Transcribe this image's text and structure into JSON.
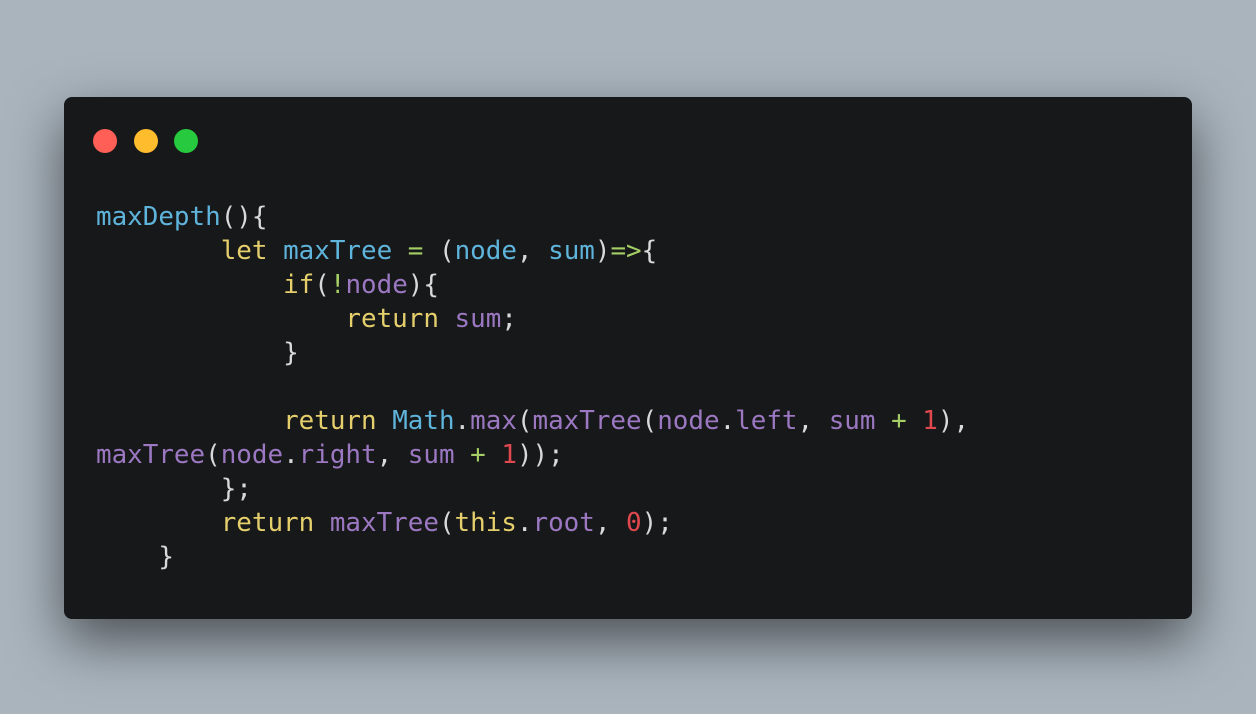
{
  "window": {
    "controls": [
      {
        "name": "close",
        "color": "#ff5f56"
      },
      {
        "name": "minimize",
        "color": "#ffbd2e"
      },
      {
        "name": "maximize",
        "color": "#27c93f"
      }
    ]
  },
  "colors": {
    "background": "#a9b4bd",
    "editor_background": "#171819",
    "function": "#5fb4dc",
    "identifier": "#9b78c1",
    "keyword": "#e5cf6c",
    "number": "#e0484f",
    "operator": "#a5cf66",
    "punctuation": "#d9d9d9"
  },
  "code": {
    "lines": [
      [
        {
          "t": "maxDepth",
          "c": "fn"
        },
        {
          "t": "(){",
          "c": "pun"
        }
      ],
      [
        {
          "t": "        ",
          "c": "pun"
        },
        {
          "t": "let",
          "c": "kw"
        },
        {
          "t": " ",
          "c": "pun"
        },
        {
          "t": "maxTree",
          "c": "fn"
        },
        {
          "t": " ",
          "c": "pun"
        },
        {
          "t": "=",
          "c": "op"
        },
        {
          "t": " (",
          "c": "pun"
        },
        {
          "t": "node",
          "c": "fn"
        },
        {
          "t": ", ",
          "c": "pun"
        },
        {
          "t": "sum",
          "c": "fn"
        },
        {
          "t": ")",
          "c": "pun"
        },
        {
          "t": "=>",
          "c": "op"
        },
        {
          "t": "{",
          "c": "pun"
        }
      ],
      [
        {
          "t": "            ",
          "c": "pun"
        },
        {
          "t": "if",
          "c": "kw"
        },
        {
          "t": "(",
          "c": "pun"
        },
        {
          "t": "!",
          "c": "op"
        },
        {
          "t": "node",
          "c": "id"
        },
        {
          "t": "){",
          "c": "pun"
        }
      ],
      [
        {
          "t": "                ",
          "c": "pun"
        },
        {
          "t": "return",
          "c": "kw"
        },
        {
          "t": " ",
          "c": "pun"
        },
        {
          "t": "sum",
          "c": "id"
        },
        {
          "t": ";",
          "c": "pun"
        }
      ],
      [
        {
          "t": "            ",
          "c": "pun"
        },
        {
          "t": "}",
          "c": "pun"
        }
      ],
      [],
      [
        {
          "t": "            ",
          "c": "pun"
        },
        {
          "t": "return",
          "c": "kw"
        },
        {
          "t": " ",
          "c": "pun"
        },
        {
          "t": "Math",
          "c": "fn"
        },
        {
          "t": ".",
          "c": "pun"
        },
        {
          "t": "max",
          "c": "id"
        },
        {
          "t": "(",
          "c": "pun"
        },
        {
          "t": "maxTree",
          "c": "id"
        },
        {
          "t": "(",
          "c": "pun"
        },
        {
          "t": "node",
          "c": "id"
        },
        {
          "t": ".",
          "c": "pun"
        },
        {
          "t": "left",
          "c": "id"
        },
        {
          "t": ", ",
          "c": "pun"
        },
        {
          "t": "sum",
          "c": "id"
        },
        {
          "t": " ",
          "c": "pun"
        },
        {
          "t": "+",
          "c": "op"
        },
        {
          "t": " ",
          "c": "pun"
        },
        {
          "t": "1",
          "c": "num"
        },
        {
          "t": "),",
          "c": "pun"
        }
      ],
      [
        {
          "t": "maxTree",
          "c": "id"
        },
        {
          "t": "(",
          "c": "pun"
        },
        {
          "t": "node",
          "c": "id"
        },
        {
          "t": ".",
          "c": "pun"
        },
        {
          "t": "right",
          "c": "id"
        },
        {
          "t": ", ",
          "c": "pun"
        },
        {
          "t": "sum",
          "c": "id"
        },
        {
          "t": " ",
          "c": "pun"
        },
        {
          "t": "+",
          "c": "op"
        },
        {
          "t": " ",
          "c": "pun"
        },
        {
          "t": "1",
          "c": "num"
        },
        {
          "t": "));",
          "c": "pun"
        }
      ],
      [
        {
          "t": "        ",
          "c": "pun"
        },
        {
          "t": "};",
          "c": "pun"
        }
      ],
      [
        {
          "t": "        ",
          "c": "pun"
        },
        {
          "t": "return",
          "c": "kw"
        },
        {
          "t": " ",
          "c": "pun"
        },
        {
          "t": "maxTree",
          "c": "id"
        },
        {
          "t": "(",
          "c": "pun"
        },
        {
          "t": "this",
          "c": "kw"
        },
        {
          "t": ".",
          "c": "pun"
        },
        {
          "t": "root",
          "c": "id"
        },
        {
          "t": ", ",
          "c": "pun"
        },
        {
          "t": "0",
          "c": "num"
        },
        {
          "t": ");",
          "c": "pun"
        }
      ],
      [
        {
          "t": "    ",
          "c": "pun"
        },
        {
          "t": "}",
          "c": "pun"
        }
      ]
    ]
  }
}
